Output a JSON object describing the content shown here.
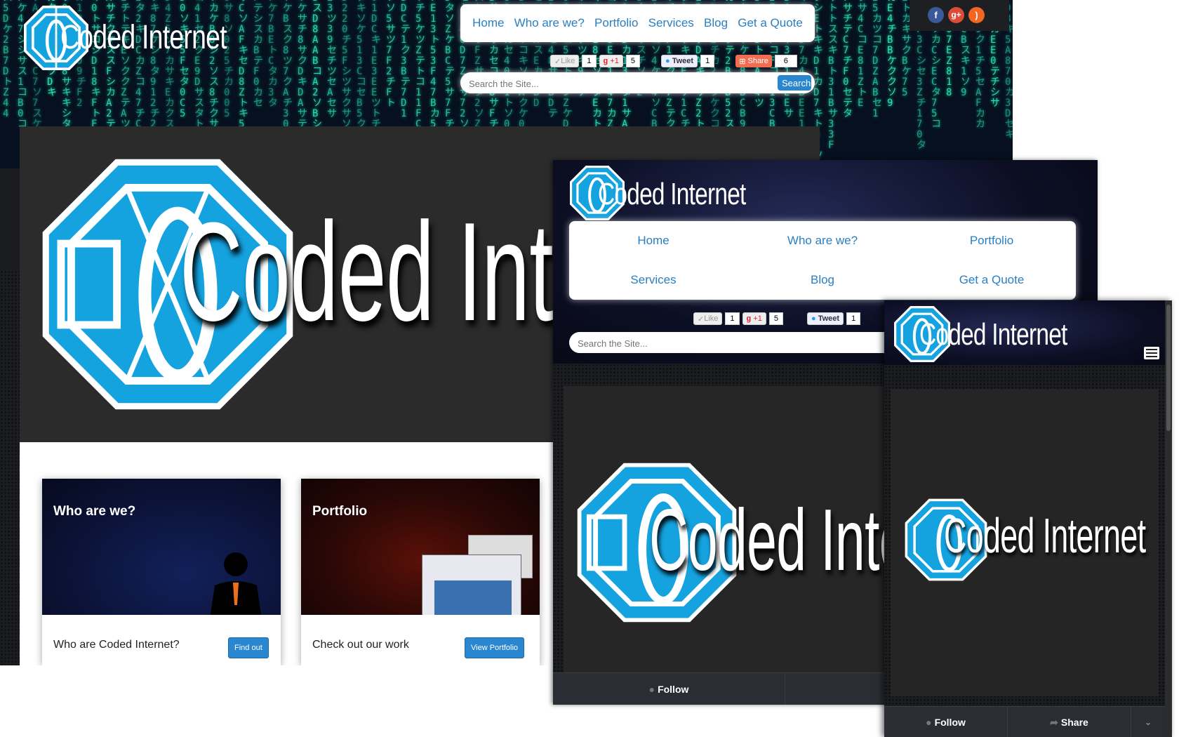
{
  "brand": {
    "name": "Coded Internet"
  },
  "colors": {
    "accent": "#2a86cf",
    "link": "#2a7fc1",
    "logo_blue": "#15a3e0",
    "matrix_green": "#2fe0c0"
  },
  "desktop": {
    "nav": [
      "Home",
      "Who are we?",
      "Portfolio",
      "Services",
      "Blog",
      "Get a Quote"
    ],
    "social_icons": [
      "facebook-icon",
      "google-plus-icon",
      "rss-icon"
    ],
    "share": {
      "like_label": "Like",
      "like_count": "1",
      "plusone_label": "+1",
      "plusone_count": "5",
      "tweet_label": "Tweet",
      "tweet_count": "1",
      "share_label": "Share",
      "share_count": "6"
    },
    "search": {
      "placeholder": "Search the Site...",
      "button": "Search"
    },
    "cards": [
      {
        "title": "Who are we?",
        "text": "Who are Coded Internet?",
        "button": "Find out"
      },
      {
        "title": "Portfolio",
        "text": "Check out our work",
        "button": "View Portfolio"
      }
    ]
  },
  "tablet": {
    "nav": [
      "Home",
      "Who are we?",
      "Portfolio",
      "Services",
      "Blog",
      "Get a Quote"
    ],
    "share": {
      "like_label": "Like",
      "like_count": "1",
      "plusone_label": "+1",
      "plusone_count": "5",
      "tweet_label": "Tweet",
      "tweet_count": "1"
    },
    "search": {
      "placeholder": "Search the Site..."
    },
    "bar": {
      "follow": "Follow"
    }
  },
  "phone": {
    "menu_icon": "hamburger-icon",
    "bar": {
      "follow": "Follow",
      "share": "Share"
    }
  }
}
